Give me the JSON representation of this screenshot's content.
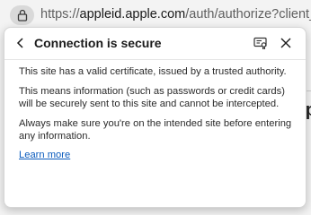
{
  "address_bar": {
    "url_prefix": "https://",
    "url_host": "appleid.apple.com",
    "url_rest": "/auth/authorize?client_id=com."
  },
  "popup": {
    "title": "Connection is secure",
    "paragraph_1": "This site has a valid certificate, issued by a trusted authority.",
    "paragraph_2": "This means information (such as passwords or credit cards) will be securely sent to this site and cannot be intercepted.",
    "paragraph_3": "Always make sure you're on the intended site before entering any information.",
    "learn_more": "Learn more"
  },
  "background_page": {
    "edge_text": "ap"
  },
  "icons": {
    "lock": "lock-icon",
    "back": "back-arrow-icon",
    "certificate": "certificate-icon",
    "close": "close-icon"
  },
  "colors": {
    "link": "#0a5bbd",
    "lock_button_bg": "#d9d9d9"
  }
}
